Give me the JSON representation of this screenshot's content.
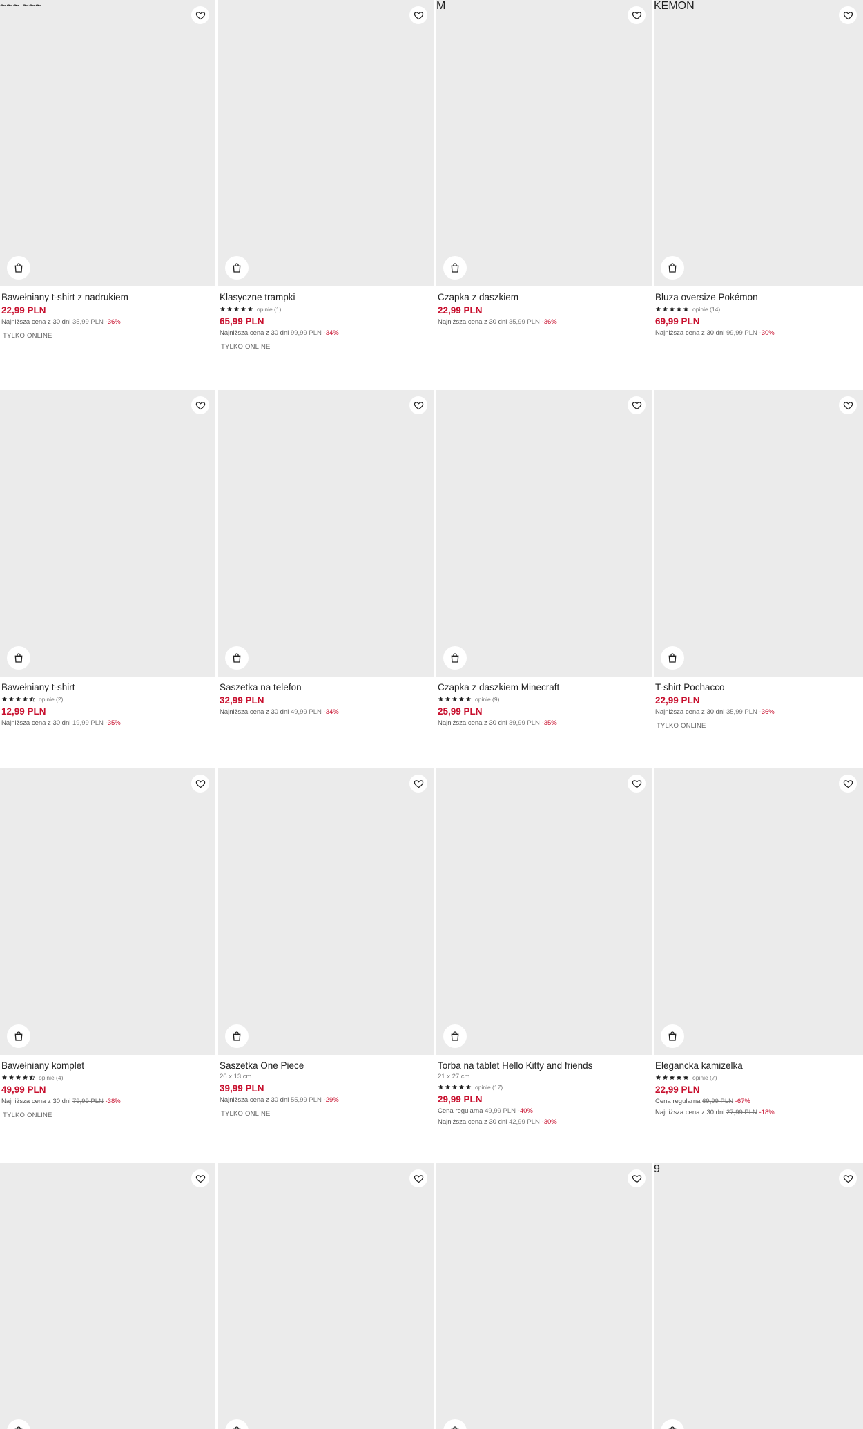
{
  "ui": {
    "accent_color": "#c8102e",
    "favorite_icon": "heart-icon",
    "add_to_cart_icon": "shopping-bag-icon",
    "star_icon": "star-icon"
  },
  "products": [
    {
      "name": "Bawełniany t-shirt z nadrukiem",
      "price": "22,99 PLN",
      "lowest_prefix": "Najniższa cena z 30 dni",
      "lowest_old": "35,99 PLN",
      "lowest_discount": "-36%",
      "badge": "TYLKO ONLINE",
      "art": "tshirt-boy"
    },
    {
      "name": "Klasyczne trampki",
      "rating": 5,
      "reviews": "opinie (1)",
      "price": "65,99 PLN",
      "lowest_prefix": "Najniższa cena z 30 dni",
      "lowest_old": "99,99 PLN",
      "lowest_discount": "-34%",
      "badge": "TYLKO ONLINE",
      "art": "sneaker"
    },
    {
      "name": "Czapka z daszkiem",
      "price": "22,99 PLN",
      "lowest_prefix": "Najniższa cena z 30 dni",
      "lowest_old": "35,99 PLN",
      "lowest_discount": "-36%",
      "art": "cap-green"
    },
    {
      "name": "Bluza oversize Pokémon",
      "rating": 5,
      "reviews": "opinie (14)",
      "price": "69,99 PLN",
      "lowest_prefix": "Najniższa cena z 30 dni",
      "lowest_old": "99,99 PLN",
      "lowest_discount": "-30%",
      "art": "hoodie-boy"
    },
    {
      "name": "Bawełniany t-shirt",
      "rating": 4.5,
      "reviews": "opinie (2)",
      "price": "12,99 PLN",
      "lowest_prefix": "Najniższa cena z 30 dni",
      "lowest_old": "19,99 PLN",
      "lowest_discount": "-35%",
      "art": "tshirt-mint"
    },
    {
      "name": "Saszetka na telefon",
      "price": "32,99 PLN",
      "lowest_prefix": "Najniższa cena z 30 dni",
      "lowest_old": "49,99 PLN",
      "lowest_discount": "-34%",
      "art": "phone-bag"
    },
    {
      "name": "Czapka z daszkiem Minecraft",
      "rating": 5,
      "reviews": "opinie (9)",
      "price": "25,99 PLN",
      "lowest_prefix": "Najniższa cena z 30 dni",
      "lowest_old": "39,99 PLN",
      "lowest_discount": "-35%",
      "art": "cap-beige"
    },
    {
      "name": "T-shirt Pochacco",
      "price": "22,99 PLN",
      "lowest_prefix": "Najniższa cena z 30 dni",
      "lowest_old": "35,99 PLN",
      "lowest_discount": "-36%",
      "badge": "TYLKO ONLINE",
      "art": "tshirt-pochacco"
    },
    {
      "name": "Bawełniany komplet",
      "rating": 4.5,
      "reviews": "opinie (4)",
      "price": "49,99 PLN",
      "lowest_prefix": "Najniższa cena z 30 dni",
      "lowest_old": "79,99 PLN",
      "lowest_discount": "-38%",
      "badge": "TYLKO ONLINE",
      "art": "set-boy"
    },
    {
      "name": "Saszetka One Piece",
      "dims": "26 x 13 cm",
      "price": "39,99 PLN",
      "lowest_prefix": "Najniższa cena z 30 dni",
      "lowest_old": "55,99 PLN",
      "lowest_discount": "-29%",
      "badge": "TYLKO ONLINE",
      "art": "waist-bag"
    },
    {
      "name": "Torba na tablet Hello Kitty and friends",
      "dims": "21 x 27 cm",
      "rating": 5,
      "reviews": "opinie (17)",
      "price": "29,99 PLN",
      "regular_prefix": "Cena regularna",
      "regular_old": "49,99 PLN",
      "regular_discount": "-40%",
      "lowest_prefix": "Najniższa cena z 30 dni",
      "lowest_old": "42,99 PLN",
      "lowest_discount": "-30%",
      "art": "tablet-bag"
    },
    {
      "name": "Elegancka kamizelka",
      "rating": 5,
      "reviews": "opinie (7)",
      "price": "22,99 PLN",
      "regular_prefix": "Cena regularna",
      "regular_old": "69,99 PLN",
      "regular_discount": "-67%",
      "lowest_prefix": "Najniższa cena z 30 dni",
      "lowest_old": "27,99 PLN",
      "lowest_discount": "-18%",
      "art": "suit-boy"
    },
    {
      "art": "romper"
    },
    {
      "art": "shirt-boy"
    },
    {
      "art": "pikachu-boy"
    },
    {
      "art": "football-set"
    }
  ]
}
